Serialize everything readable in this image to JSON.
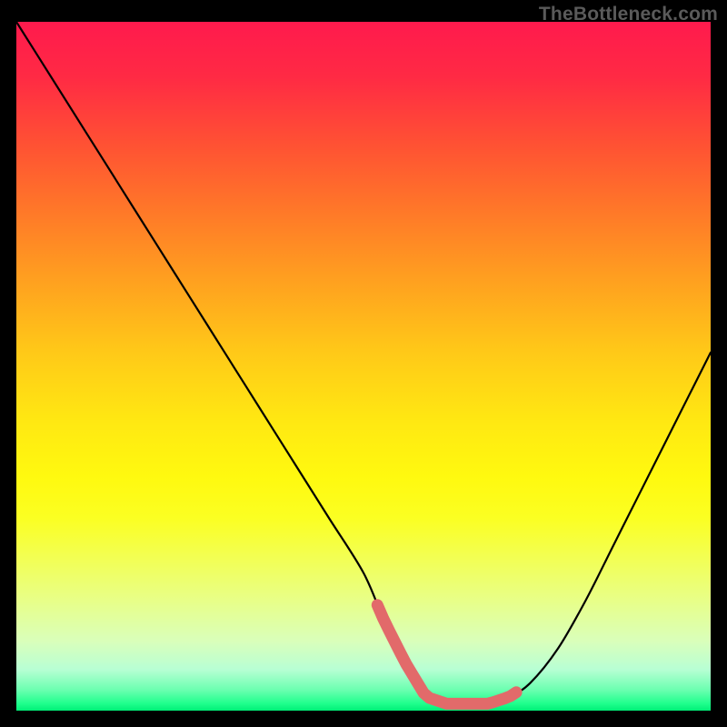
{
  "watermark": "TheBottleneck.com",
  "chart_data": {
    "type": "line",
    "title": "",
    "xlabel": "",
    "ylabel": "",
    "xlim": [
      0,
      100
    ],
    "ylim": [
      0,
      100
    ],
    "series": [
      {
        "name": "bottleneck-curve",
        "x": [
          0,
          5,
          10,
          15,
          20,
          25,
          30,
          35,
          40,
          45,
          50,
          53,
          56,
          59,
          62,
          65,
          68,
          71,
          74,
          78,
          82,
          86,
          90,
          95,
          100
        ],
        "values": [
          100,
          92,
          84,
          76,
          68,
          60,
          52,
          44,
          36,
          28,
          20,
          13,
          7,
          2,
          1,
          1,
          1,
          2,
          4,
          9,
          16,
          24,
          32,
          42,
          52
        ]
      }
    ],
    "highlight": {
      "name": "optimal-range",
      "x_start": 52,
      "x_end": 72,
      "color": "#e26a6a"
    },
    "background_gradient": {
      "stops": [
        {
          "pos": 0.0,
          "color": "#ff1a4d"
        },
        {
          "pos": 0.3,
          "color": "#ff7a28"
        },
        {
          "pos": 0.6,
          "color": "#ffe812"
        },
        {
          "pos": 0.85,
          "color": "#e8ff88"
        },
        {
          "pos": 1.0,
          "color": "#00ee77"
        }
      ]
    }
  }
}
